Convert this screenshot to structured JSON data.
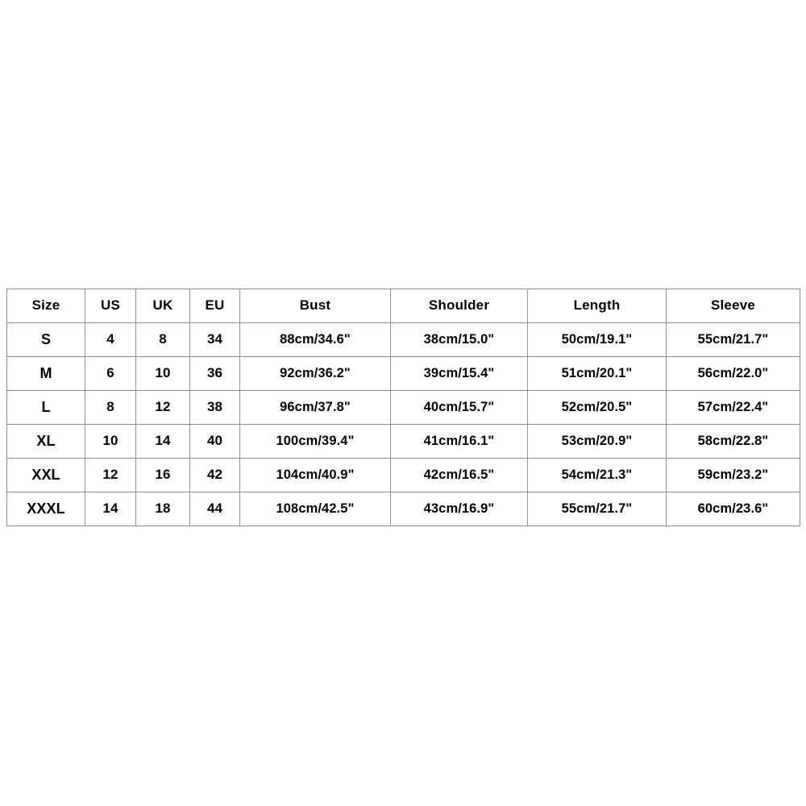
{
  "page": {
    "background_color": "#ffffff",
    "text_color": "#000000",
    "border_color": "#8d8d8d"
  },
  "size_chart": {
    "columns": [
      "Size",
      "US",
      "UK",
      "EU",
      "Bust",
      "Shoulder",
      "Length",
      "Sleeve"
    ],
    "rows": [
      {
        "size": "S",
        "us": "4",
        "uk": "8",
        "eu": "34",
        "bust": "88cm/34.6\"",
        "shoulder": "38cm/15.0\"",
        "length": "50cm/19.1\"",
        "sleeve": "55cm/21.7\""
      },
      {
        "size": "M",
        "us": "6",
        "uk": "10",
        "eu": "36",
        "bust": "92cm/36.2\"",
        "shoulder": "39cm/15.4\"",
        "length": "51cm/20.1\"",
        "sleeve": "56cm/22.0\""
      },
      {
        "size": "L",
        "us": "8",
        "uk": "12",
        "eu": "38",
        "bust": "96cm/37.8\"",
        "shoulder": "40cm/15.7\"",
        "length": "52cm/20.5\"",
        "sleeve": "57cm/22.4\""
      },
      {
        "size": "XL",
        "us": "10",
        "uk": "14",
        "eu": "40",
        "bust": "100cm/39.4\"",
        "shoulder": "41cm/16.1\"",
        "length": "53cm/20.9\"",
        "sleeve": "58cm/22.8\""
      },
      {
        "size": "XXL",
        "us": "12",
        "uk": "16",
        "eu": "42",
        "bust": "104cm/40.9\"",
        "shoulder": "42cm/16.5\"",
        "length": "54cm/21.3\"",
        "sleeve": "59cm/23.2\""
      },
      {
        "size": "XXXL",
        "us": "14",
        "uk": "18",
        "eu": "44",
        "bust": "108cm/42.5\"",
        "shoulder": "43cm/16.9\"",
        "length": "55cm/21.7\"",
        "sleeve": "60cm/23.6\""
      }
    ]
  }
}
